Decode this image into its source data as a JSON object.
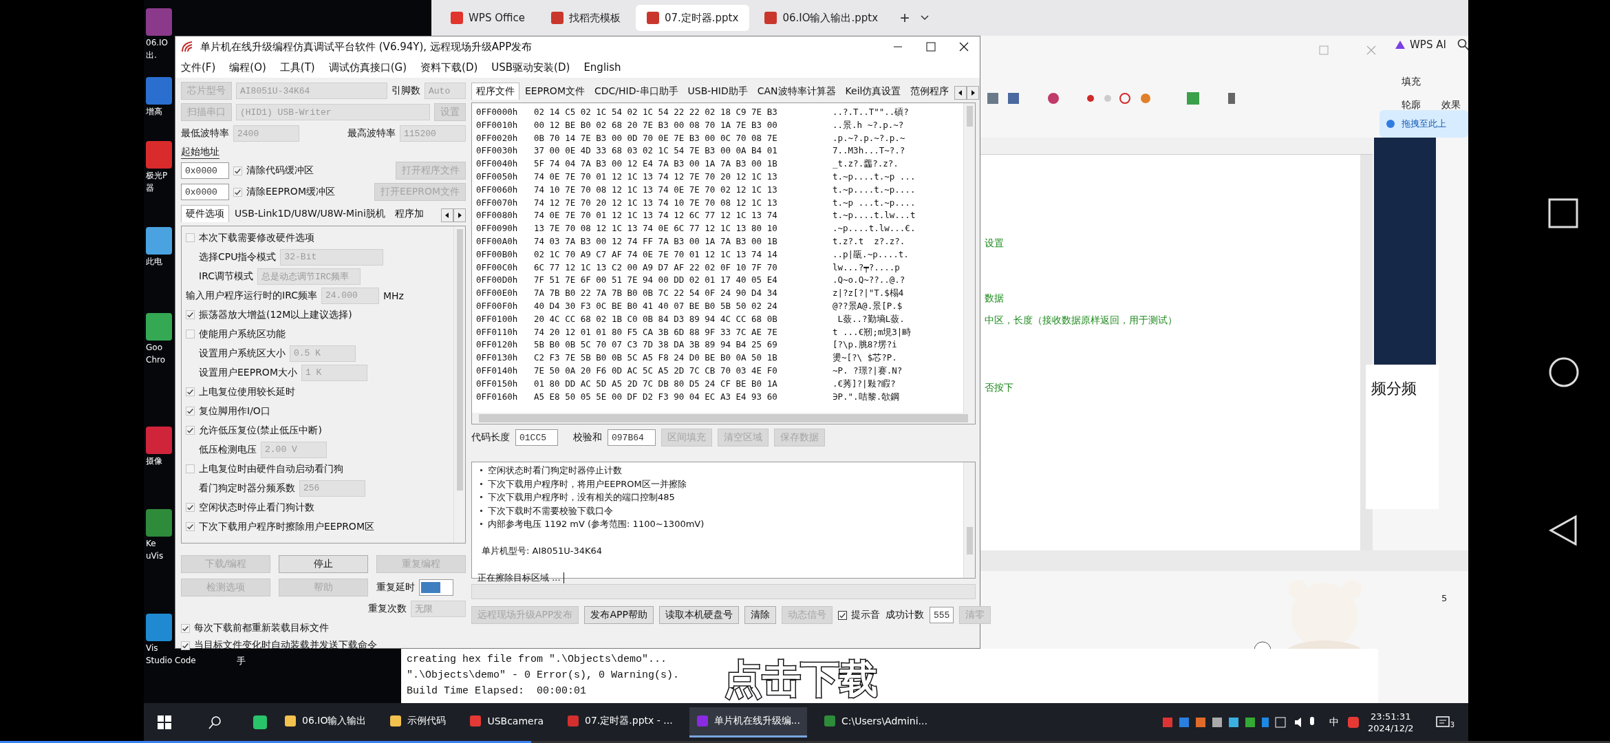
{
  "desktop_icons": [
    {
      "lines": [
        "06.IO",
        "出."
      ],
      "color": "#8b3a8b"
    },
    {
      "lines": [
        "增高"
      ],
      "color": "#2a6fd0"
    },
    {
      "lines": [
        "极光P",
        "器"
      ],
      "color": "#d92b2b"
    },
    {
      "lines": [
        "此电"
      ],
      "color": "#4aa3e0"
    },
    {
      "lines": [
        "Goo",
        "Chro"
      ],
      "color": "#34a853"
    },
    {
      "lines": [
        "摄像"
      ],
      "color": "#d0243a"
    },
    {
      "lines": [
        "Ke",
        "uVis"
      ],
      "color": "#2e8b3a"
    },
    {
      "lines": [
        "Vis",
        "Studio Code"
      ],
      "color": "#1f8ad2"
    }
  ],
  "hidden_icon_label": "手",
  "wps": {
    "tabs": [
      {
        "label": "WPS Office",
        "selected": false
      },
      {
        "label": "找稻壳模板",
        "selected": false
      },
      {
        "label": "07.定时器.pptx",
        "selected": true
      },
      {
        "label": "06.IO输入输出.pptx",
        "selected": false
      }
    ],
    "new_tab": "+",
    "ai_label": "WPS AI",
    "fill_label": "填充",
    "outline_label": "轮廓",
    "effect_label": "效果",
    "drop_hint": "拖拽至此上",
    "slide_title": "频分频",
    "slide_number": "5"
  },
  "keil": {
    "editor_lines": [
      "设置",
      "数据",
      "中区，长度（接收数据原样返回，用于测试）",
      "否按下"
    ],
    "build_output": [
      "creating hex file from \".\\Objects\\demo\"...",
      "\".\\Objects\\demo\" - 0 Error(s), 0 Warning(s).",
      "Build Time Elapsed:  00:00:01"
    ]
  },
  "caption": "点击下载",
  "main_window": {
    "title": "单片机在线升级编程仿真调试平台软件 (V6.94Y), 远程现场升级APP发布",
    "menu": [
      "文件(F)",
      "编程(O)",
      "工具(T)",
      "调试仿真接口(G)",
      "资料下载(D)",
      "USB驱动安装(D)",
      "English"
    ],
    "chip": {
      "button": {
        "label": "芯片型号",
        "disabled": true
      },
      "value": "AI8051U-34K64",
      "pins_label": "引脚数",
      "pins_value": "Auto"
    },
    "port": {
      "button": {
        "label": "扫描串口",
        "disabled": true
      },
      "value": "(HID1) USB-Writer",
      "settings_button": {
        "label": "设置",
        "disabled": true
      }
    },
    "baud": {
      "min_label": "最低波特率",
      "min_value": "2400",
      "max_label": "最高波特率",
      "max_value": "115200"
    },
    "start_address_label": "起始地址",
    "address_rows": [
      {
        "value": "0x0000",
        "clear": {
          "label": "清除代码缓冲区",
          "checked": true
        },
        "open_button": {
          "label": "打开程序文件",
          "disabled": true
        }
      },
      {
        "value": "0x0000",
        "clear": {
          "label": "清除EEPROM缓冲区",
          "checked": true
        },
        "open_button": {
          "label": "打开EEPROM文件",
          "disabled": true
        }
      }
    ],
    "left_tabs": [
      {
        "label": "硬件选项",
        "selected": true
      },
      {
        "label": "USB-Link1D/U8W/U8W-Mini脱机",
        "selected": false
      },
      {
        "label": "程序加",
        "selected": false
      }
    ],
    "options": [
      {
        "kind": "checkbox",
        "label": "本次下载需要修改硬件选项",
        "checked": false
      },
      {
        "kind": "select",
        "label": "选择CPU指令模式",
        "value": "32-Bit"
      },
      {
        "kind": "select",
        "label": "IRC调节模式",
        "value": "总是动态调节IRC频率"
      },
      {
        "kind": "frequency",
        "label": "输入用户程序运行时的IRC频率",
        "value": "24.000",
        "unit": "MHz"
      },
      {
        "kind": "checkbox",
        "label": "振荡器放大增益(12M以上建议选择)",
        "checked": true
      },
      {
        "kind": "checkbox",
        "label": "使能用户系统区功能",
        "checked": false
      },
      {
        "kind": "field",
        "label": "设置用户系统区大小",
        "value": "0.5 K"
      },
      {
        "kind": "field",
        "label": "设置用户EEPROM大小",
        "value": "1 K"
      },
      {
        "kind": "checkbox",
        "label": "上电复位使用较长延时",
        "checked": true
      },
      {
        "kind": "checkbox",
        "label": "复位脚用作I/O口",
        "checked": true
      },
      {
        "kind": "checkbox",
        "label": "允许低压复位(禁止低压中断)",
        "checked": true
      },
      {
        "kind": "field",
        "label": "低压检测电压",
        "value": "2.00 V"
      },
      {
        "kind": "checkbox",
        "label": "上电复位时由硬件自动启动看门狗",
        "checked": false
      },
      {
        "kind": "field",
        "label": "看门狗定时器分频系数",
        "value": "256"
      },
      {
        "kind": "checkbox",
        "label": "空闲状态时停止看门狗计数",
        "checked": true
      },
      {
        "kind": "checkbox",
        "label": "下次下载用户程序时擦除用户EEPROM区",
        "checked": true
      }
    ],
    "actions": [
      {
        "label": "下载/编程",
        "disabled": true
      },
      {
        "label": "停止",
        "disabled": false
      },
      {
        "label": "重复编程",
        "disabled": true
      },
      {
        "label": "检测选项",
        "disabled": true
      },
      {
        "label": "帮助",
        "disabled": true
      }
    ],
    "repeat_delay_label": "重复延时",
    "repeat_count_label": "重复次数",
    "repeat_count": "无限",
    "reload_options": [
      {
        "label": "每次下载前都重新装载目标文件",
        "checked": true
      },
      {
        "label": "当目标文件变化时自动装载并发送下载命令",
        "checked": true
      }
    ],
    "right_tabs": [
      {
        "label": "程序文件",
        "selected": true
      },
      {
        "label": "EEPROM文件",
        "selected": false
      },
      {
        "label": "CDC/HID-串口助手",
        "selected": false
      },
      {
        "label": "USB-HID助手",
        "selected": false
      },
      {
        "label": "CAN波特率计算器",
        "selected": false
      },
      {
        "label": "Keil仿真设置",
        "selected": false
      },
      {
        "label": "范例程序",
        "selected": false
      }
    ],
    "hex_rows": [
      {
        "address": "0FF0000h",
        "bytes": "02 14 C5 02 1C 54 02 1C 54 22 22 02 18 C9 7E B3",
        "ascii": "..?.T..T\"\"..碽?"
      },
      {
        "address": "0FF0010h",
        "bytes": "00 12 BE B0 02 68 20 7E B3 00 08 70 1A 7E B3 00",
        "ascii": "..景.h ~?.p.~?"
      },
      {
        "address": "0FF0020h",
        "bytes": "0B 70 14 7E B3 00 0D 70 0E 7E B3 00 0C 70 08 7E",
        "ascii": ".p.~?.p.~?.p.~"
      },
      {
        "address": "0FF0030h",
        "bytes": "37 00 0E 4D 33 68 03 02 1C 54 7E B3 00 0A B4 01",
        "ascii": "7..M3h...T~?.?"
      },
      {
        "address": "0FF0040h",
        "bytes": "5F 74 04 7A B3 00 12 E4 7A B3 00 1A 7A B3 00 1B",
        "ascii": "_t.z?.齹?.z?."
      },
      {
        "address": "0FF0050h",
        "bytes": "74 0E 7E 70 01 12 1C 13 74 12 7E 70 20 12 1C 13",
        "ascii": "t.~p....t.~p ..."
      },
      {
        "address": "0FF0060h",
        "bytes": "74 10 7E 70 08 12 1C 13 74 0E 7E 70 02 12 1C 13",
        "ascii": "t.~p....t.~p...."
      },
      {
        "address": "0FF0070h",
        "bytes": "74 12 7E 70 20 12 1C 13 74 10 7E 70 08 12 1C 13",
        "ascii": "t.~p ...t.~p...."
      },
      {
        "address": "0FF0080h",
        "bytes": "74 0E 7E 70 01 12 1C 13 74 12 6C 77 12 1C 13 74",
        "ascii": "t.~p....t.lw...t"
      },
      {
        "address": "0FF0090h",
        "bytes": "13 7E 70 08 12 1C 13 74 0E 6C 77 12 1C 13 80 10",
        "ascii": ".~p....t.lw...€."
      },
      {
        "address": "0FF00A0h",
        "bytes": "74 03 7A B3 00 12 74 FF 7A B3 00 1A 7A B3 00 1B",
        "ascii": "t.z?.t  z?.z?."
      },
      {
        "address": "0FF00B0h",
        "bytes": "02 1C 70 A9 C7 AF 74 0E 7E 70 01 12 1C 13 74 14",
        "ascii": "..p|瓹.~p....t."
      },
      {
        "address": "0FF00C0h",
        "bytes": "6C 77 12 1C 13 C2 00 A9 D7 AF 22 02 0F 10 7F 70",
        "ascii": "lw...?┯?....p"
      },
      {
        "address": "0FF00D0h",
        "bytes": "7F 51 7E 6F 00 51 7E 94 00 DD 02 01 17 40 05 E4",
        "ascii": ".Q~o.Q~??..@.?"
      },
      {
        "address": "0FF00E0h",
        "bytes": "7A 7B B0 22 7A 7B B0 0B 7C 22 54 0F 24 90 D4 34",
        "ascii": "z|?z[?|\"T.$榻4"
      },
      {
        "address": "0FF00F0h",
        "bytes": "40 D4 30 F3 0C BE B0 41 40 07 BE B0 5B 50 02 24",
        "ascii": "@??景A@.景[P.$"
      },
      {
        "address": "0FF0100h",
        "bytes": "20 4C CC 68 02 1B C0 0B 84 D3 89 94 4C CC 68 0B",
        "ascii": " L蔹..?勤墒L蔹."
      },
      {
        "address": "0FF0110h",
        "bytes": "74 20 12 01 01 80 F5 CA 3B 6D 88 9F 33 7C AE 7E",
        "ascii": "t ...€剏;m垷3|畤"
      },
      {
        "address": "0FF0120h",
        "bytes": "5B B0 0B 5C 70 07 C3 7D 38 DA 3B 89 94 B4 25 69",
        "ascii": "[?\\p.脁8?塄?i"
      },
      {
        "address": "0FF0130h",
        "bytes": "C2 F3 7E 5B B0 0B 5C A5 F8 24 D0 BE B0 0A 50 1B",
        "ascii": "燙~[?\\ $芯?P."
      },
      {
        "address": "0FF0140h",
        "bytes": "7E 50 0A 20 F6 0D AC 5C A5 2D 7C CB 70 03 4E F0",
        "ascii": "~P. ?璟?|赛.N?"
      },
      {
        "address": "0FF0150h",
        "bytes": "01 80 DD AC 5D A5 2D 7C DB 80 D5 24 CF BE B0 1A",
        "ascii": ".€莠]?|敤?睱?"
      },
      {
        "address": "0FF0160h",
        "bytes": "A5 E8 50 05 5E 00 DF D2 F3 90 04 EC A3 E4 93 60",
        "ascii": "∋P.\".咭黎.欹鋼"
      }
    ],
    "code_length_label": "代码长度",
    "code_length": "01CC5",
    "checksum_label": "校验和",
    "checksum": "097B64",
    "hex_buttons": [
      {
        "label": "区间填充",
        "disabled": true
      },
      {
        "label": "清空区域",
        "disabled": true
      },
      {
        "label": "保存数据",
        "disabled": true
      }
    ],
    "log_lines": [
      {
        "kind": "bullet",
        "text": "空闲状态时看门狗定时器停止计数"
      },
      {
        "kind": "bullet",
        "text": "下次下载用户程序时，将用户EEPROM区一并擦除"
      },
      {
        "kind": "bullet",
        "text": "下次下载用户程序时，没有相关的端口控制485"
      },
      {
        "kind": "bullet",
        "text": "下次下载时不需要校验下载口令"
      },
      {
        "kind": "bullet",
        "text": "内部参考电压  1192 mV (参考范围: 1100~1300mV)"
      },
      {
        "kind": "gap"
      },
      {
        "kind": "plain",
        "text": "单片机型号: AI8051U-34K64"
      },
      {
        "kind": "gap"
      },
      {
        "kind": "status",
        "text": "正在擦除目标区域 ..."
      }
    ],
    "bottom_buttons": [
      {
        "label": "远程现场升级APP发布",
        "disabled": true
      },
      {
        "label": "发布APP帮助",
        "disabled": false
      },
      {
        "label": "读取本机硬盘号",
        "disabled": false
      },
      {
        "label": "清除",
        "disabled": false
      },
      {
        "label": "动态信号",
        "disabled": true
      }
    ],
    "sound": {
      "label": "提示音",
      "checked": true
    },
    "success_label": "成功计数",
    "success_count": "555",
    "reset_button": {
      "label": "清零",
      "disabled": true
    }
  },
  "taskbar": {
    "items": [
      {
        "label": "06.IO输入输出",
        "kind": "folder",
        "selected": false
      },
      {
        "label": "示例代码",
        "kind": "folder",
        "selected": false
      },
      {
        "label": "USBcamera",
        "kind": "camera",
        "selected": false
      },
      {
        "label": "07.定时器.pptx - ...",
        "kind": "wps",
        "selected": false
      },
      {
        "label": "单片机在线升级编...",
        "kind": "chip",
        "selected": true
      },
      {
        "label": "C:\\Users\\Admini...",
        "kind": "keil",
        "selected": false
      }
    ],
    "ime": "中",
    "time": "23:51:31",
    "date": "2024/12/2",
    "notification_count": "3"
  },
  "video_progress": {
    "level": 0.33
  }
}
